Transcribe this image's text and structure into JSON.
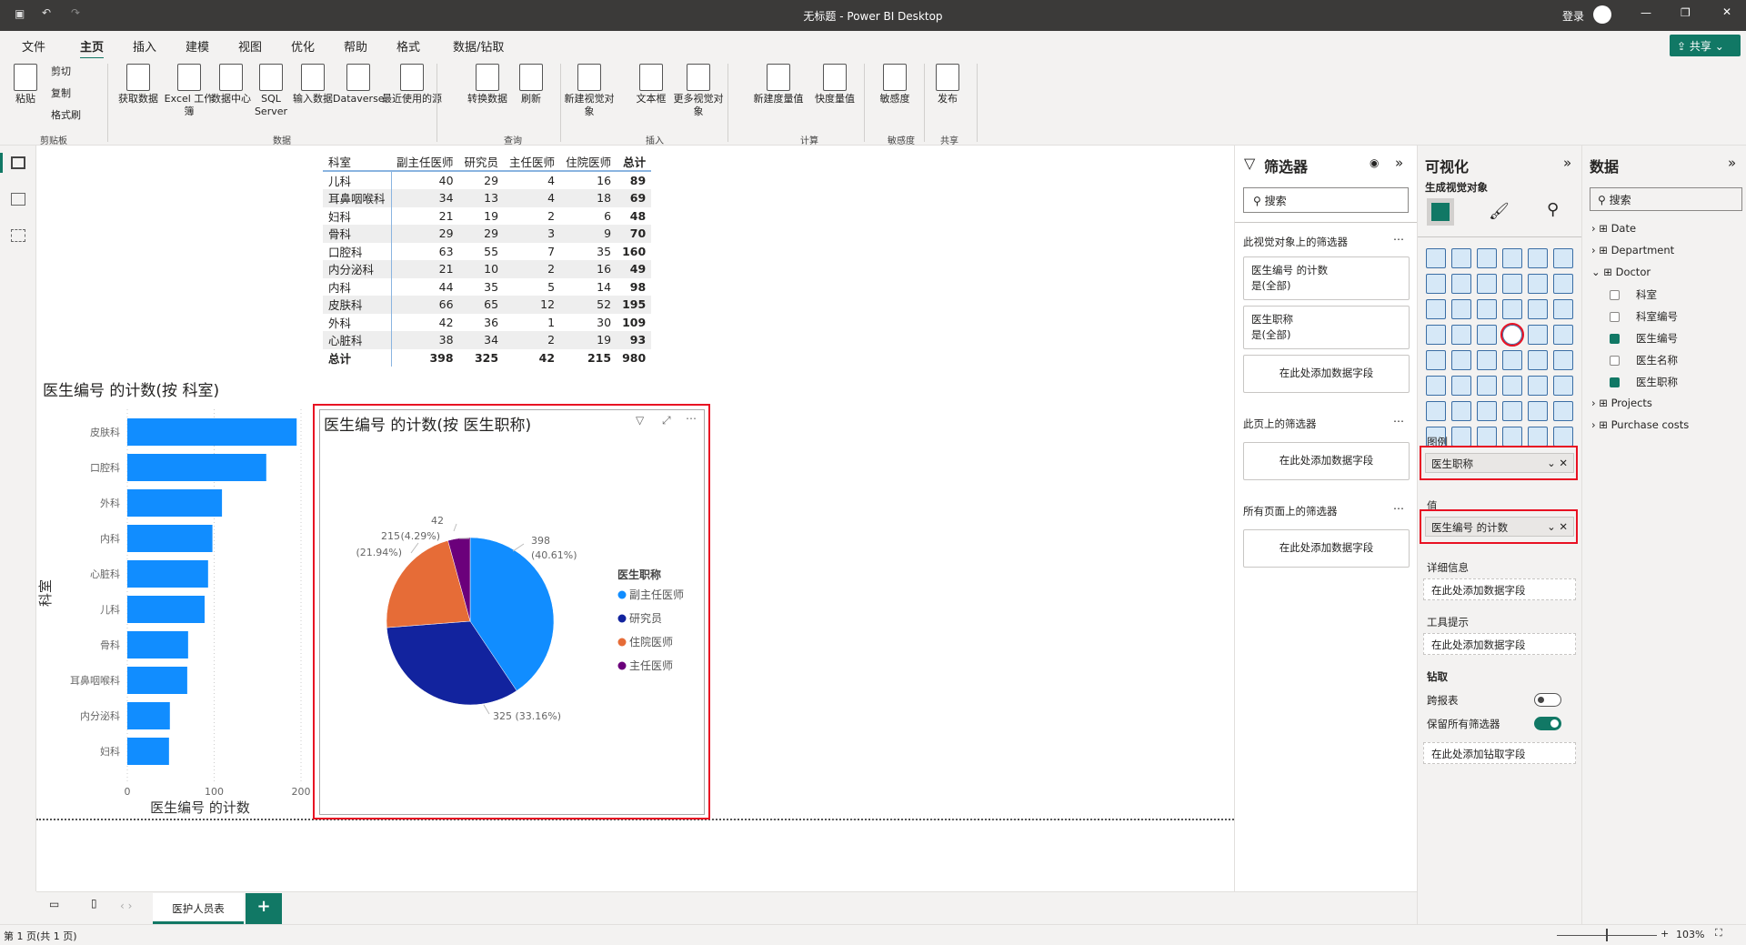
{
  "window": {
    "title": "无标题 - Power BI Desktop",
    "signin": "登录",
    "share": "共享"
  },
  "menu": [
    "文件",
    "主页",
    "插入",
    "建模",
    "视图",
    "优化",
    "帮助",
    "格式",
    "数据/钻取"
  ],
  "ribbon": {
    "clipboard": {
      "paste": "粘贴",
      "cut": "剪切",
      "copy": "复制",
      "format_painter": "格式刷",
      "group": "剪贴板"
    },
    "data": {
      "items": [
        "获取数据",
        "Excel 工作簿",
        "数据中心",
        "SQL Server",
        "输入数据",
        "Dataverse",
        "最近使用的源"
      ],
      "group": "数据"
    },
    "query": {
      "items": [
        "转换数据",
        "刷新"
      ],
      "group": "查询"
    },
    "insert": {
      "items": [
        "新建视觉对象",
        "文本框",
        "更多视觉对象"
      ],
      "group": "插入"
    },
    "calc": {
      "items": [
        "新建度量值",
        "快度量值"
      ],
      "group": "计算"
    },
    "sensitivity": {
      "items": [
        "敏感度"
      ],
      "group": "敏感度"
    },
    "share": {
      "items": [
        "发布"
      ],
      "group": "共享"
    }
  },
  "matrix": {
    "headers": [
      "科室",
      "副主任医师",
      "研究员",
      "主任医师",
      "住院医师",
      "总计"
    ],
    "rows": [
      [
        "儿科",
        40,
        29,
        4,
        16,
        89
      ],
      [
        "耳鼻咽喉科",
        34,
        13,
        4,
        18,
        69
      ],
      [
        "妇科",
        21,
        19,
        2,
        6,
        48
      ],
      [
        "骨科",
        29,
        29,
        3,
        9,
        70
      ],
      [
        "口腔科",
        63,
        55,
        7,
        35,
        160
      ],
      [
        "内分泌科",
        21,
        10,
        2,
        16,
        49
      ],
      [
        "内科",
        44,
        35,
        5,
        14,
        98
      ],
      [
        "皮肤科",
        66,
        65,
        12,
        52,
        195
      ],
      [
        "外科",
        42,
        36,
        1,
        30,
        109
      ],
      [
        "心脏科",
        38,
        34,
        2,
        19,
        93
      ]
    ],
    "total": [
      "总计",
      398,
      325,
      42,
      215,
      980
    ]
  },
  "chart_data": [
    {
      "type": "bar",
      "orientation": "horizontal",
      "title": "医生编号 的计数(按 科室)",
      "xlabel": "医生编号 的计数",
      "ylabel": "科室",
      "categories": [
        "皮肤科",
        "口腔科",
        "外科",
        "内科",
        "心脏科",
        "儿科",
        "骨科",
        "耳鼻咽喉科",
        "内分泌科",
        "妇科"
      ],
      "values": [
        195,
        160,
        109,
        98,
        93,
        89,
        70,
        69,
        49,
        48
      ],
      "xlim": [
        0,
        200
      ],
      "xticks": [
        "0",
        "100",
        "200"
      ],
      "color": "#118dff",
      "grid": true
    },
    {
      "type": "pie",
      "title": "医生编号 的计数(按 医生职称)",
      "legend_title": "医生职称",
      "legend_position": "right",
      "series": [
        {
          "name": "副主任医师",
          "value": 398,
          "label": "398",
          "pct": "(40.61%)",
          "color": "#118dff"
        },
        {
          "name": "研究员",
          "value": 325,
          "label": "325 (33.16%)",
          "pct": "",
          "color": "#12239e"
        },
        {
          "name": "住院医师",
          "value": 215,
          "label": "215",
          "pct": "(21.94%)",
          "color": "#e66c37"
        },
        {
          "name": "主任医师",
          "value": 42,
          "label": "42",
          "pct": "(4.29%)",
          "color": "#6b007b"
        }
      ]
    }
  ],
  "filters": {
    "title": "筛选器",
    "search": "搜索",
    "visual_section": "此视觉对象上的筛选器",
    "cards": [
      {
        "name": "医生编号 的计数",
        "value": "是(全部)"
      },
      {
        "name": "医生职称",
        "value": "是(全部)"
      }
    ],
    "add": "在此处添加数据字段",
    "page_section": "此页上的筛选器",
    "all_section": "所有页面上的筛选器"
  },
  "viz": {
    "title": "可视化",
    "build": "生成视觉对象",
    "legend": "图例",
    "legend_field": "医生职称",
    "values": "值",
    "values_field": "医生编号 的计数",
    "details": "详细信息",
    "tooltips": "工具提示",
    "add": "在此处添加数据字段",
    "drill": "钻取",
    "cross_report": "跨报表",
    "cross_report_on": false,
    "keep_filters": "保留所有筛选器",
    "keep_filters_on": true,
    "add_drill": "在此处添加钻取字段"
  },
  "datapane": {
    "title": "数据",
    "search": "搜索",
    "tables": [
      "Date",
      "Department",
      "Doctor",
      "Projects",
      "Purchase costs"
    ],
    "doctor_fields": [
      {
        "name": "科室",
        "checked": false
      },
      {
        "name": "科室编号",
        "checked": false
      },
      {
        "name": "医生编号",
        "checked": true
      },
      {
        "name": "医生名称",
        "checked": false
      },
      {
        "name": "医生职称",
        "checked": true
      }
    ]
  },
  "pages": {
    "tab": "医护人员表",
    "add": "+"
  },
  "status": {
    "page": "第 1 页(共 1 页)",
    "zoom": "103%"
  },
  "colors": {
    "accent": "#117865",
    "selection": "#e81123"
  }
}
